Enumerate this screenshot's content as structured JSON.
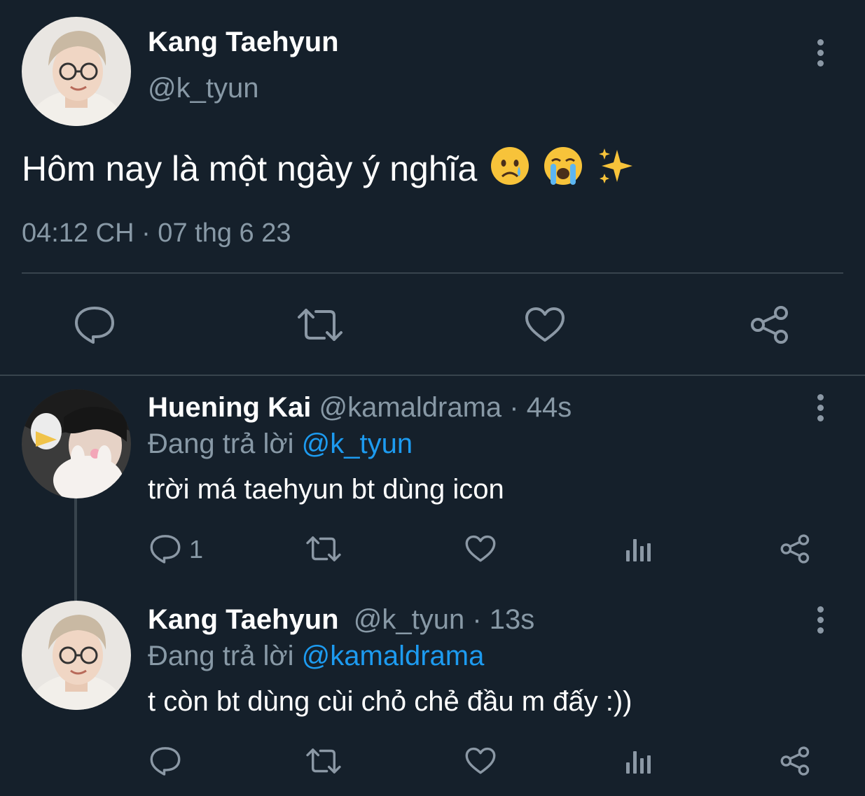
{
  "main_tweet": {
    "author_name": "Kang Taehyun",
    "author_handle": "@k_tyun",
    "text": "Hôm nay là một ngày ý nghĩa",
    "emojis": [
      "crying-face-icon",
      "loudly-crying-face-icon",
      "sparkles-icon"
    ],
    "timestamp": "04:12 CH · 07 thg 6 23",
    "actions": [
      "reply-icon",
      "retweet-icon",
      "like-icon",
      "share-icon"
    ]
  },
  "replies": [
    {
      "author_name": "Huening Kai",
      "author_handle": "@kamaldrama",
      "time": "· 44s",
      "replying_label": "Đang trả lời",
      "replying_to": "@k_tyun",
      "text": "trời má taehyun bt dùng icon",
      "reply_count": "1"
    },
    {
      "author_name": "Kang Taehyun",
      "author_handle": "@k_tyun",
      "time": "· 13s",
      "replying_label": "Đang trả lời",
      "replying_to": "@kamaldrama",
      "text": "t còn bt dùng cùi chỏ chẻ đầu m đấy :))",
      "reply_count": ""
    }
  ],
  "colors": {
    "background": "#15202b",
    "muted_text": "#8899a6",
    "link": "#1d9bf0",
    "divider": "#38444d"
  }
}
